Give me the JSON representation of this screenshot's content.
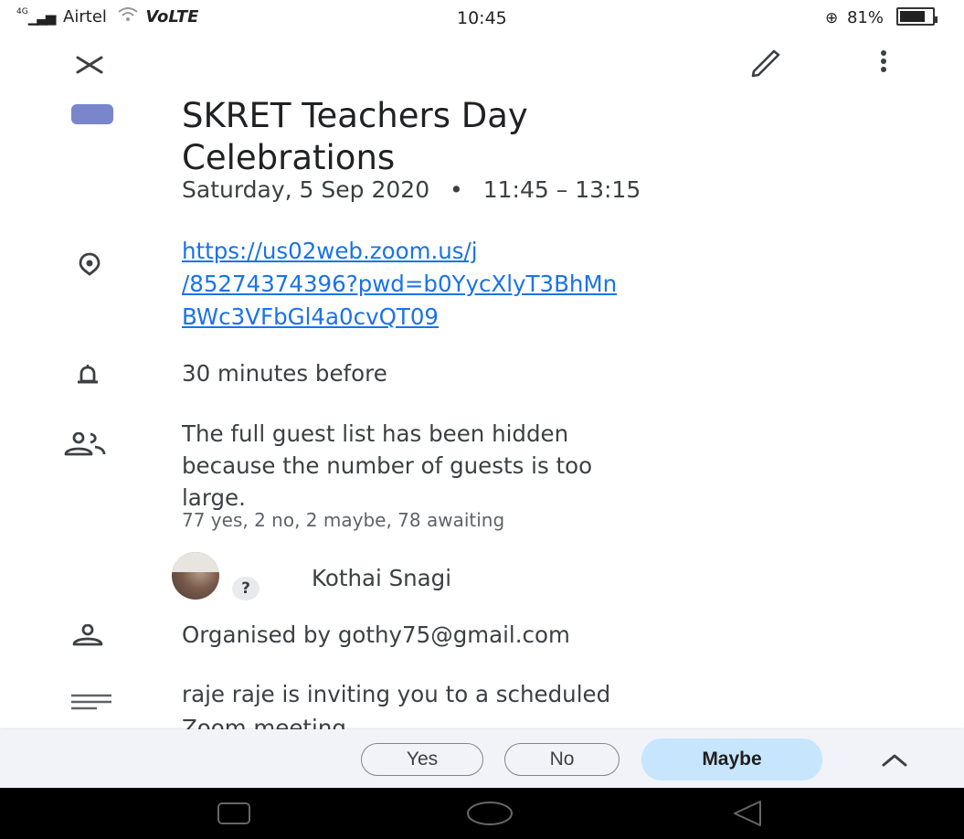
{
  "status": {
    "network": "Airtel",
    "network_type": "VoLTE",
    "signal_badge": "4G",
    "time": "10:45",
    "battery": "81%"
  },
  "appbar": {
    "close_icon": "close-icon",
    "edit_icon": "pencil-icon",
    "more_icon": "more-vert-icon"
  },
  "event": {
    "color": "#7986cb",
    "title": "SKRET Teachers Day Celebrations",
    "title_line1": "SKRET Teachers Day",
    "title_line2": "Celebrations",
    "date": "Saturday, 5 Sep 2020",
    "separator": "•",
    "time": "11:45 – 13:15",
    "link_lines": [
      "https://us02web.zoom.us/j",
      "/85274374396?pwd=b0YycXlyT3BhMn",
      "BWc3VFbGl4a0cvQT09"
    ],
    "reminder": "30 minutes before",
    "guest_notice_lines": [
      "The full guest list has been hidden",
      "because the number of guests is too",
      "large."
    ],
    "guest_summary": "77 yes, 2 no, 2 maybe, 78 awaiting",
    "guest_name": "Kothai Snagi",
    "guest_status_badge": "?",
    "organizer": "Organised by gothy75@gmail.com",
    "description_lines": [
      "raje raje is inviting you to a scheduled",
      "Zoom meeting."
    ]
  },
  "rsvp": {
    "yes": "Yes",
    "no": "No",
    "maybe": "Maybe",
    "selected": "Maybe",
    "accent": "#c7e6fd"
  }
}
